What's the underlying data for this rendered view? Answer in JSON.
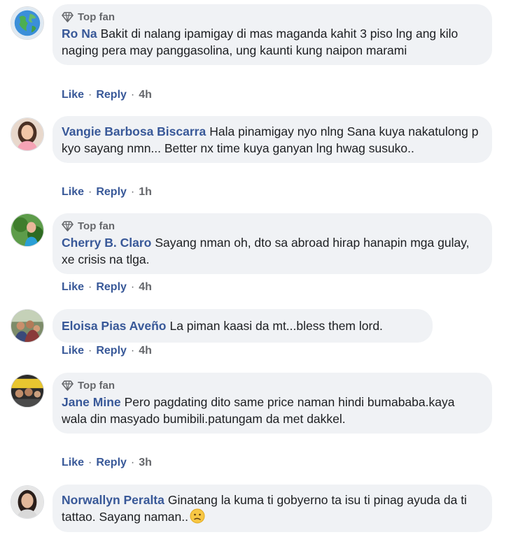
{
  "comments": [
    {
      "top_fan": "Top fan",
      "author": "Ro Na",
      "text": "Bakit di nalang ipamigay di mas maganda kahit 3 piso lng ang kilo naging pera may panggasolina, ung kaunti kung naipon marami",
      "like": "Like",
      "reply": "Reply",
      "time": "4h",
      "avatar": "globe-avatar"
    },
    {
      "author": "Vangie Barbosa Biscarra",
      "text": "Hala pinamigay nyo nlng Sana kuya nakatulong p kyo sayang nmn... Better nx time kuya ganyan lng hwag susuko..",
      "like": "Like",
      "reply": "Reply",
      "time": "1h",
      "avatar": "woman-avatar"
    },
    {
      "top_fan": "Top fan",
      "author": "Cherry B. Claro",
      "text": "Sayang nman oh, dto sa abroad hirap hanapin mga gulay, xe crisis na tlga.",
      "like": "Like",
      "reply": "Reply",
      "time": "4h",
      "avatar": "plants-avatar"
    },
    {
      "author": "Eloisa Pias Aveño",
      "text": "La piman kaasi da mt...bless them lord.",
      "like": "Like",
      "reply": "Reply",
      "time": "4h",
      "avatar": "family-avatar"
    },
    {
      "top_fan": "Top fan",
      "author": "Jane Mine",
      "text": "Pero pagdating dito same price naman hindi bumababa.kaya wala din masyado bumibili.patungam da met dakkel.",
      "like": "Like",
      "reply": "Reply",
      "time": "3h",
      "avatar": "group-avatar"
    },
    {
      "author": "Norwallyn Peralta",
      "text": "Ginatang la kuma ti gobyerno ta isu ti pinag ayuda da ti tattao. Sayang naman..",
      "emoji": "confused-face",
      "avatar": "portrait-avatar"
    }
  ],
  "colors": {
    "author": "#385898",
    "bubble": "#f0f2f5",
    "meta": "#65676b"
  }
}
